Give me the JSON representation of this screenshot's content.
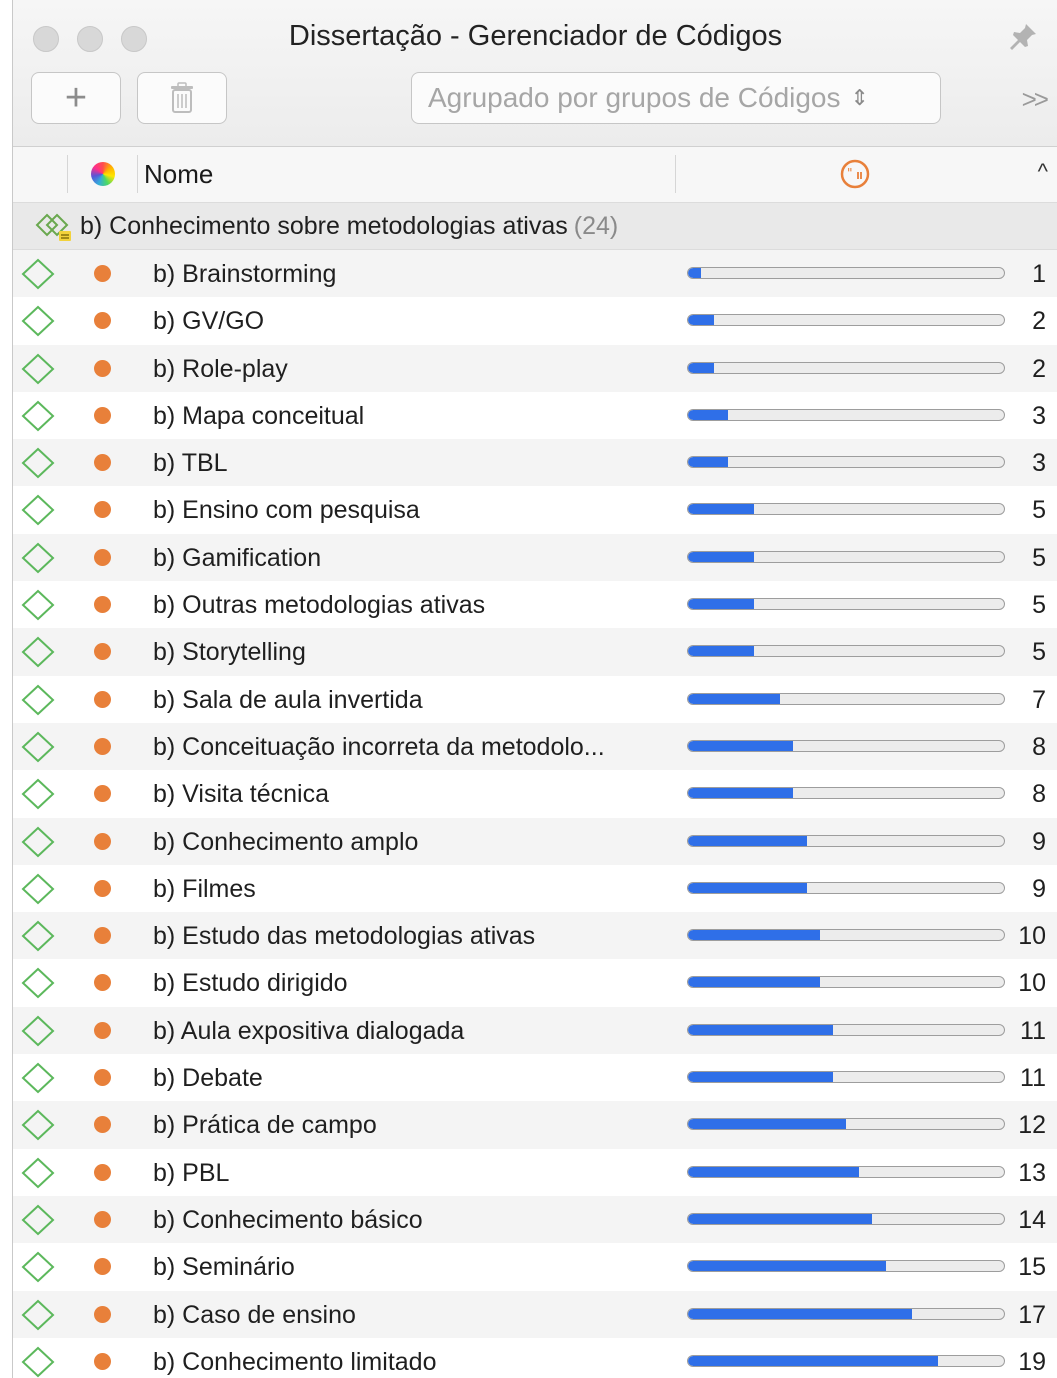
{
  "window": {
    "title": "Dissertação - Gerenciador de Códigos"
  },
  "toolbar": {
    "add_label": "+",
    "group_select_value": "Agrupado por grupos de Códigos",
    "overflow_label": ">>"
  },
  "table": {
    "columns": {
      "name": "Nome"
    },
    "group": {
      "label": "b) Conhecimento sobre metodologias ativas",
      "count": "(24)"
    },
    "max_count": 24,
    "rows": [
      {
        "label": "b) Brainstorming",
        "count": 1
      },
      {
        "label": "b) GV/GO",
        "count": 2
      },
      {
        "label": "b) Role-play",
        "count": 2
      },
      {
        "label": "b) Mapa conceitual",
        "count": 3
      },
      {
        "label": "b) TBL",
        "count": 3
      },
      {
        "label": "b) Ensino com pesquisa",
        "count": 5
      },
      {
        "label": "b) Gamification",
        "count": 5
      },
      {
        "label": "b) Outras metodologias ativas",
        "count": 5
      },
      {
        "label": "b) Storytelling",
        "count": 5
      },
      {
        "label": "b) Sala de aula invertida",
        "count": 7
      },
      {
        "label": "b) Conceituação incorreta da metodolo...",
        "count": 8
      },
      {
        "label": "b) Visita técnica",
        "count": 8
      },
      {
        "label": "b) Conhecimento amplo",
        "count": 9
      },
      {
        "label": "b) Filmes",
        "count": 9
      },
      {
        "label": "b) Estudo das metodologias ativas",
        "count": 10
      },
      {
        "label": "b) Estudo dirigido",
        "count": 10
      },
      {
        "label": "b) Aula expositiva dialogada",
        "count": 11
      },
      {
        "label": "b) Debate",
        "count": 11
      },
      {
        "label": "b) Prática de campo",
        "count": 12
      },
      {
        "label": "b) PBL",
        "count": 13
      },
      {
        "label": "b) Conhecimento básico",
        "count": 14
      },
      {
        "label": "b) Seminário",
        "count": 15
      },
      {
        "label": "b) Caso de ensino",
        "count": 17
      },
      {
        "label": "b) Conhecimento limitado",
        "count": 19
      }
    ]
  },
  "colors": {
    "code_dot": "#e8803a",
    "bar_fill": "#2f6fe8",
    "code_icon": "#4caf50",
    "frequency_icon": "#e8803a"
  },
  "icons": {
    "row_code": "code-diamond-icon",
    "row_color": "color-dot-icon",
    "header_color": "color-wheel-icon",
    "header_frequency": "frequency-icon",
    "group": "code-group-icon"
  }
}
